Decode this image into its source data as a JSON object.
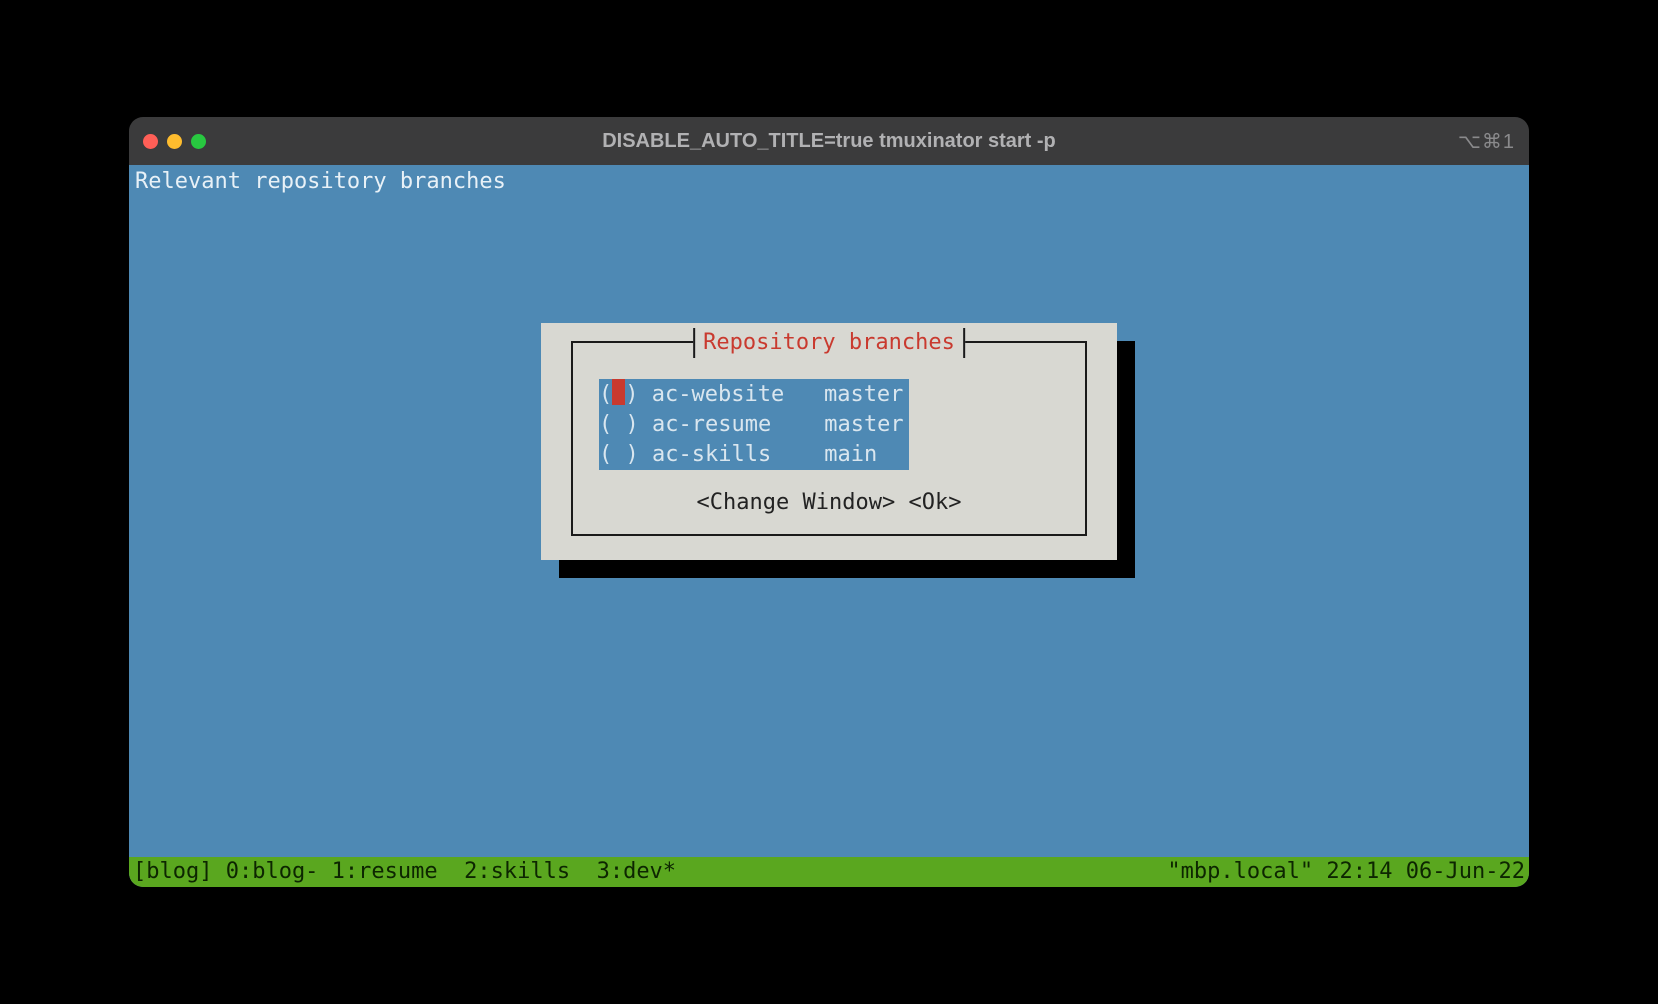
{
  "window": {
    "title": "DISABLE_AUTO_TITLE=true tmuxinator start -p",
    "shortcut": "⌥⌘1"
  },
  "terminal": {
    "header": "Relevant repository branches"
  },
  "dialog": {
    "title": "Repository branches",
    "items": [
      {
        "radio_open": "(",
        "radio_close": ")",
        "cursor": true,
        "name": "ac-website",
        "branch": "master"
      },
      {
        "radio_open": "(",
        "radio_close": ")",
        "cursor": false,
        "name": "ac-resume",
        "branch": "master"
      },
      {
        "radio_open": "(",
        "radio_close": ")",
        "cursor": false,
        "name": "ac-skills",
        "branch": "main"
      }
    ],
    "buttons": {
      "change": "<Change Window>",
      "ok": "<Ok>"
    }
  },
  "statusbar": {
    "left": "[blog] 0:blog- 1:resume  2:skills  3:dev*",
    "right": "\"mbp.local\" 22:14 06-Jun-22"
  }
}
